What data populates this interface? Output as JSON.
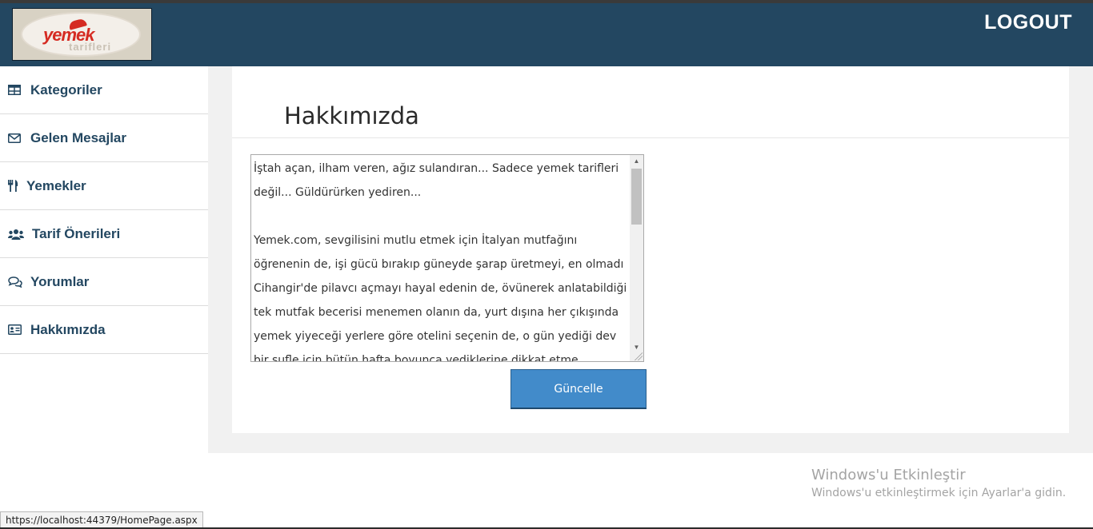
{
  "header": {
    "logo": {
      "main_text": "yemek",
      "sub_text": "tarifleri"
    },
    "logout_label": "LOGOUT"
  },
  "sidebar": {
    "items": [
      {
        "label": "Kategoriler",
        "icon": "table-icon"
      },
      {
        "label": "Gelen Mesajlar",
        "icon": "envelope-icon"
      },
      {
        "label": "Yemekler",
        "icon": "utensils-icon"
      },
      {
        "label": "Tarif Önerileri",
        "icon": "users-icon"
      },
      {
        "label": "Yorumlar",
        "icon": "comments-icon"
      },
      {
        "label": "Hakkımızda",
        "icon": "id-card-icon"
      }
    ]
  },
  "main": {
    "title": "Hakkımızda",
    "about_text": "İştah açan, ilham veren, ağız sulandıran... Sadece yemek tarifleri değil... Güldürürken yediren...\n\nYemek.com, sevgilisini mutlu etmek için İtalyan mutfağını öğrenenin de, işi gücü bırakıp güneyde şarap üretmeyi, en olmadı Cihangir'de pilavcı açmayı hayal edenin de, övünerek anlatabildiği tek mutfak becerisi menemen olanın da, yurt dışına her çıkışında yemek yiyeceği yerlere göre otelini seçenin de, o gün yediği dev bir sufle için bütün hafta boyunca yediklerine dikkat etme zorunluluğu hissedenin de, yemeğin",
    "update_button": "Güncelle"
  },
  "os_overlay": {
    "watermark_title": "Windows'u Etkinleştir",
    "watermark_sub": "Windows'u etkinleştirmek için Ayarlar'a gidin."
  },
  "status_bar": {
    "url": "https://localhost:44379/HomePage.aspx"
  },
  "colors": {
    "header_bg": "#234761",
    "sidebar_text": "#234761",
    "button_bg": "#428bca",
    "page_bg": "#f1f1f1"
  }
}
